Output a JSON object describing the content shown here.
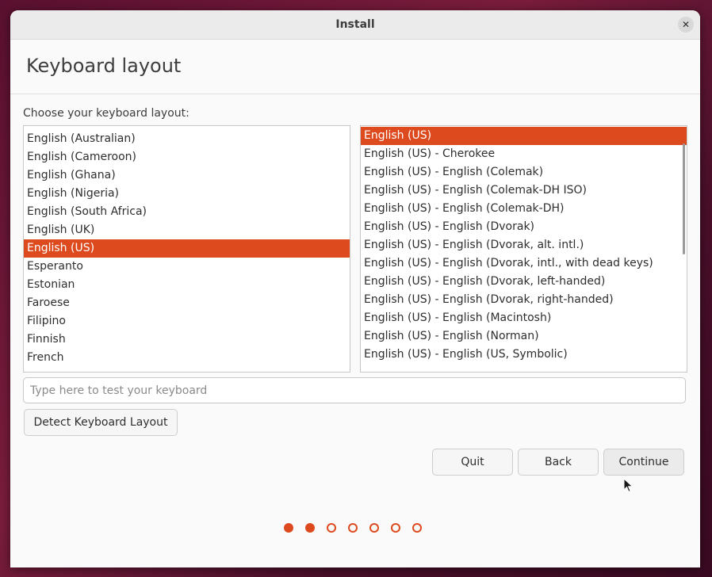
{
  "window": {
    "title": "Install",
    "close_glyph": "✕"
  },
  "page": {
    "heading": "Keyboard layout",
    "prompt": "Choose your keyboard layout:"
  },
  "layouts": {
    "items": [
      "English (Australian)",
      "English (Cameroon)",
      "English (Ghana)",
      "English (Nigeria)",
      "English (South Africa)",
      "English (UK)",
      "English (US)",
      "Esperanto",
      "Estonian",
      "Faroese",
      "Filipino",
      "Finnish",
      "French"
    ],
    "selected": "English (US)"
  },
  "variants": {
    "items": [
      "English (US)",
      "English (US) - Cherokee",
      "English (US) - English (Colemak)",
      "English (US) - English (Colemak-DH ISO)",
      "English (US) - English (Colemak-DH)",
      "English (US) - English (Dvorak)",
      "English (US) - English (Dvorak, alt. intl.)",
      "English (US) - English (Dvorak, intl., with dead keys)",
      "English (US) - English (Dvorak, left-handed)",
      "English (US) - English (Dvorak, right-handed)",
      "English (US) - English (Macintosh)",
      "English (US) - English (Norman)",
      "English (US) - English (US, Symbolic)"
    ],
    "selected": "English (US)"
  },
  "test_field": {
    "placeholder": "Type here to test your keyboard",
    "value": ""
  },
  "buttons": {
    "detect": "Detect Keyboard Layout",
    "quit": "Quit",
    "back": "Back",
    "continue": "Continue"
  },
  "progress": {
    "total_steps": 7,
    "completed_steps": 2
  },
  "colors": {
    "accent": "#dd4a1e"
  }
}
